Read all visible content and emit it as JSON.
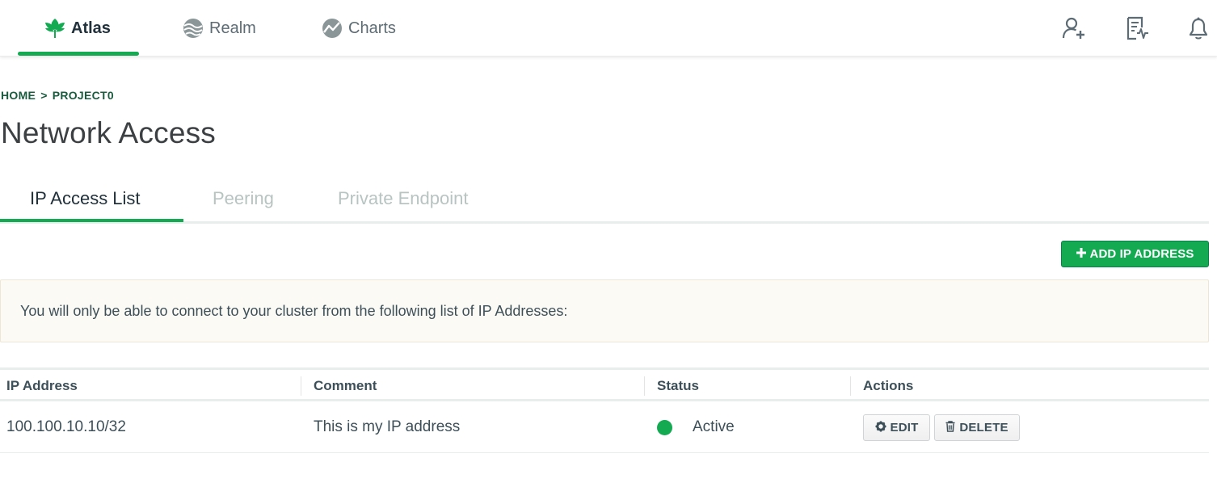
{
  "topnav": {
    "products": [
      {
        "label": "Atlas",
        "icon": "atlas-leaf-icon",
        "active": true
      },
      {
        "label": "Realm",
        "icon": "realm-icon",
        "active": false
      },
      {
        "label": "Charts",
        "icon": "charts-icon",
        "active": false
      }
    ],
    "right_icons": [
      "invite-user-icon",
      "activity-feed-icon",
      "notification-bell-icon"
    ]
  },
  "breadcrumb": {
    "home": "HOME",
    "separator": ">",
    "project": "PROJECT0"
  },
  "page": {
    "title": "Network Access"
  },
  "tabs": [
    {
      "label": "IP Access List",
      "active": true
    },
    {
      "label": "Peering",
      "active": false
    },
    {
      "label": "Private Endpoint",
      "active": false
    }
  ],
  "actions": {
    "add_ip_label": "ADD IP ADDRESS"
  },
  "banner": {
    "text": "You will only be able to connect to your cluster from the following list of IP Addresses:"
  },
  "table": {
    "columns": [
      "IP Address",
      "Comment",
      "Status",
      "Actions"
    ],
    "rows": [
      {
        "ip": "100.100.10.10/32",
        "comment": "This is my IP address",
        "status": "Active",
        "edit_label": "EDIT",
        "delete_label": "DELETE"
      }
    ]
  },
  "colors": {
    "brand_green": "#13aa52",
    "breadcrumb_green": "#1a5b3f",
    "banner_bg": "#fcfaf5",
    "inactive_tab": "#b8c4c2"
  }
}
